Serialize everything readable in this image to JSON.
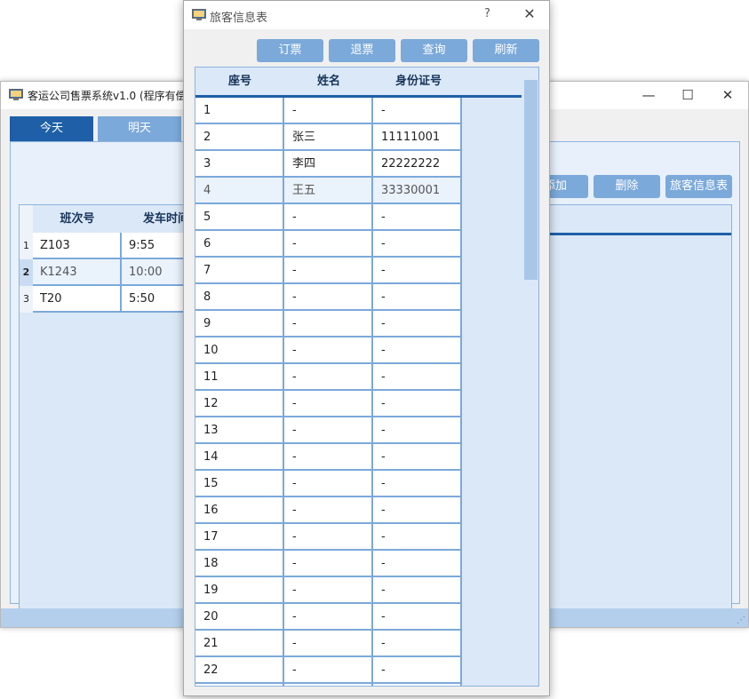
{
  "main_window": {
    "title": "客运公司售票系统v1.0 (程序有偿",
    "controls": {
      "minimize": "—",
      "maximize": "☐",
      "close": "✕"
    },
    "tabs": [
      {
        "label": "今天",
        "active": true
      },
      {
        "label": "明天",
        "active": false
      }
    ],
    "toolbar": {
      "add_label": "添加",
      "delete_label": "删除",
      "passenger_table_label": "旅客信息表"
    },
    "train_table": {
      "columns": [
        "班次号",
        "发车时间"
      ],
      "rows": [
        {
          "num": "1",
          "train": "Z103",
          "depart": "9:55"
        },
        {
          "num": "2",
          "train": "K1243",
          "depart": "10:00",
          "selected": true
        },
        {
          "num": "3",
          "train": "T20",
          "depart": "5:50"
        }
      ]
    },
    "status_grip": "⋰"
  },
  "dialog": {
    "title": "旅客信息表",
    "help": "?",
    "close": "✕",
    "buttons": {
      "book": "订票",
      "refund": "退票",
      "query": "查询",
      "refresh": "刷新"
    },
    "columns": [
      "座号",
      "姓名",
      "身份证号"
    ],
    "rows": [
      {
        "seat": "1",
        "name": "-",
        "id": "-"
      },
      {
        "seat": "2",
        "name": "张三",
        "id": "11111001"
      },
      {
        "seat": "3",
        "name": "李四",
        "id": "22222222"
      },
      {
        "seat": "4",
        "name": "王五",
        "id": "33330001",
        "selected": true
      },
      {
        "seat": "5",
        "name": "-",
        "id": "-"
      },
      {
        "seat": "6",
        "name": "-",
        "id": "-"
      },
      {
        "seat": "7",
        "name": "-",
        "id": "-"
      },
      {
        "seat": "8",
        "name": "-",
        "id": "-"
      },
      {
        "seat": "9",
        "name": "-",
        "id": "-"
      },
      {
        "seat": "10",
        "name": "-",
        "id": "-"
      },
      {
        "seat": "11",
        "name": "-",
        "id": "-"
      },
      {
        "seat": "12",
        "name": "-",
        "id": "-"
      },
      {
        "seat": "13",
        "name": "-",
        "id": "-"
      },
      {
        "seat": "14",
        "name": "-",
        "id": "-"
      },
      {
        "seat": "15",
        "name": "-",
        "id": "-"
      },
      {
        "seat": "16",
        "name": "-",
        "id": "-"
      },
      {
        "seat": "17",
        "name": "-",
        "id": "-"
      },
      {
        "seat": "18",
        "name": "-",
        "id": "-"
      },
      {
        "seat": "19",
        "name": "-",
        "id": "-"
      },
      {
        "seat": "20",
        "name": "-",
        "id": "-"
      },
      {
        "seat": "21",
        "name": "-",
        "id": "-"
      },
      {
        "seat": "22",
        "name": "-",
        "id": "-"
      },
      {
        "seat": "",
        "name": "",
        "id": ""
      }
    ]
  },
  "colors": {
    "accent": "#1e5fa8",
    "button": "#7ba9da",
    "pane": "#e7f0fb",
    "grid": "#7ba9da",
    "statusbar": "#b4cfec"
  },
  "icons": {
    "app_icon": "monitor-icon"
  }
}
